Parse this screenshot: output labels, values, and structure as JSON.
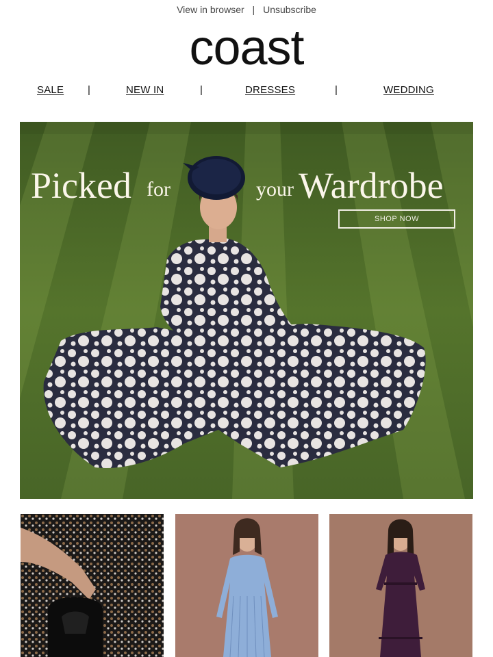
{
  "preheader": {
    "view_in_browser": "View in browser",
    "separator": "|",
    "unsubscribe": "Unsubscribe"
  },
  "brand": {
    "logo_text": "coast"
  },
  "nav": {
    "items": [
      {
        "label": "SALE"
      },
      {
        "label": "NEW IN"
      },
      {
        "label": "DRESSES"
      },
      {
        "label": "WEDDING"
      }
    ],
    "separator": "|"
  },
  "hero": {
    "headline_word1": "Picked",
    "headline_word2": "for",
    "headline_word3": "your",
    "headline_word4": "Wardrobe",
    "cta_label": "SHOP NOW",
    "colors": {
      "grass": "#4e6a2a",
      "dress": "#2a2c3f",
      "dots": "#ebe6e4",
      "text": "#fbf6ea"
    }
  },
  "product_tiles": [
    {
      "name": "sequin-dress-bag",
      "bg": "#3a3330"
    },
    {
      "name": "blue-pleated-dress",
      "bg": "#a97b6c"
    },
    {
      "name": "purple-midi-dress",
      "bg": "#a47a68"
    }
  ]
}
